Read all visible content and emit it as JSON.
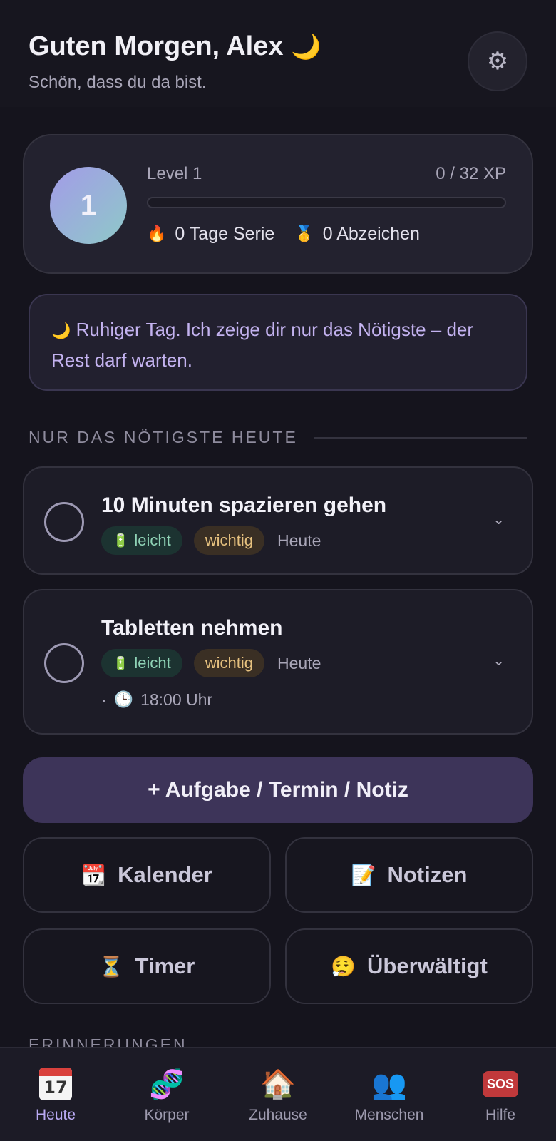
{
  "header": {
    "greeting": "Guten Morgen, Alex",
    "greeting_emoji": "🌙",
    "subtitle": "Schön, dass du da bist.",
    "settings_icon": "gear-icon"
  },
  "level_card": {
    "avatar_level": "1",
    "level_label": "Level 1",
    "xp_label": "0 / 32 XP",
    "xp_progress": 0,
    "streak_emoji": "🔥",
    "streak_text": "0 Tage Serie",
    "badges_emoji": "🥇",
    "badges_text": "0 Abzeichen"
  },
  "info": {
    "emoji": "🌙",
    "text": "Ruhiger Tag. Ich zeige dir nur das Nötigste – der Rest darf warten."
  },
  "section": {
    "title": "NUR DAS NÖTIGSTE HEUTE"
  },
  "tasks": [
    {
      "title": "10 Minuten spazieren gehen",
      "tag_easy_emoji": "🔋",
      "tag_easy": "leicht",
      "tag_important": "wichtig",
      "due": "Heute"
    },
    {
      "title": "Tabletten nehmen",
      "tag_easy_emoji": "🔋",
      "tag_easy": "leicht",
      "tag_important": "wichtig",
      "due": "Heute",
      "time_prefix": "·",
      "time_emoji": "🕒",
      "time": "18:00 Uhr"
    }
  ],
  "add_button": {
    "label": "+ Aufgabe / Termin / Notiz"
  },
  "quick_actions": [
    {
      "emoji": "📆",
      "label": "Kalender"
    },
    {
      "emoji": "📝",
      "label": "Notizen"
    },
    {
      "emoji": "⏳",
      "label": "Timer"
    },
    {
      "emoji": "😮‍💨",
      "label": "Überwältigt"
    }
  ],
  "next_section": {
    "title": "ERINNERUNGEN"
  },
  "nav": [
    {
      "label": "Heute",
      "icon": "calendar-icon"
    },
    {
      "label": "Körper",
      "icon": "dna-icon",
      "emoji": "🧬"
    },
    {
      "label": "Zuhause",
      "icon": "house-icon",
      "emoji": "🏠"
    },
    {
      "label": "Menschen",
      "icon": "people-icon",
      "emoji": "👥"
    },
    {
      "label": "Hilfe",
      "icon": "sos-icon",
      "sos_text": "SOS"
    }
  ],
  "nav_calendar_day": "17"
}
